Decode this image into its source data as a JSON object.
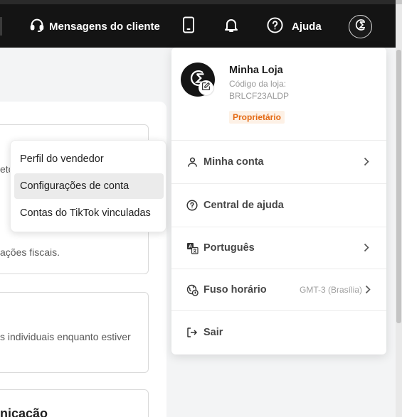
{
  "header": {
    "messages_label": "Mensagens do cliente",
    "help_label": "Ajuda",
    "icons": [
      "headset-icon",
      "phone-icon",
      "bell-icon",
      "help-icon"
    ]
  },
  "profile": {
    "store_name": "Minha Loja",
    "code_label": "Código da loja:",
    "code_value": "BRLCF23ALDP",
    "role_badge": "Proprietário"
  },
  "menu": {
    "my_account": "Minha conta",
    "help_center": "Central de ajuda",
    "language": "Português",
    "timezone_label": "Fuso horário",
    "timezone_value": "GMT-3 (Brasília)",
    "logout": "Sair"
  },
  "context_menu": {
    "items": [
      "Perfil do vendedor",
      "Configurações de conta",
      "Contas do TikTok vinculadas"
    ],
    "active_index": 1
  },
  "background": {
    "partial_1": "eto",
    "partial_2": "ações fiscais.",
    "partial_3": "s individuais enquanto estiver",
    "partial_4": "nicação"
  },
  "colors": {
    "topbar": "#141414",
    "badge_text": "#e46a14",
    "badge_bg": "#fdf1e6"
  }
}
